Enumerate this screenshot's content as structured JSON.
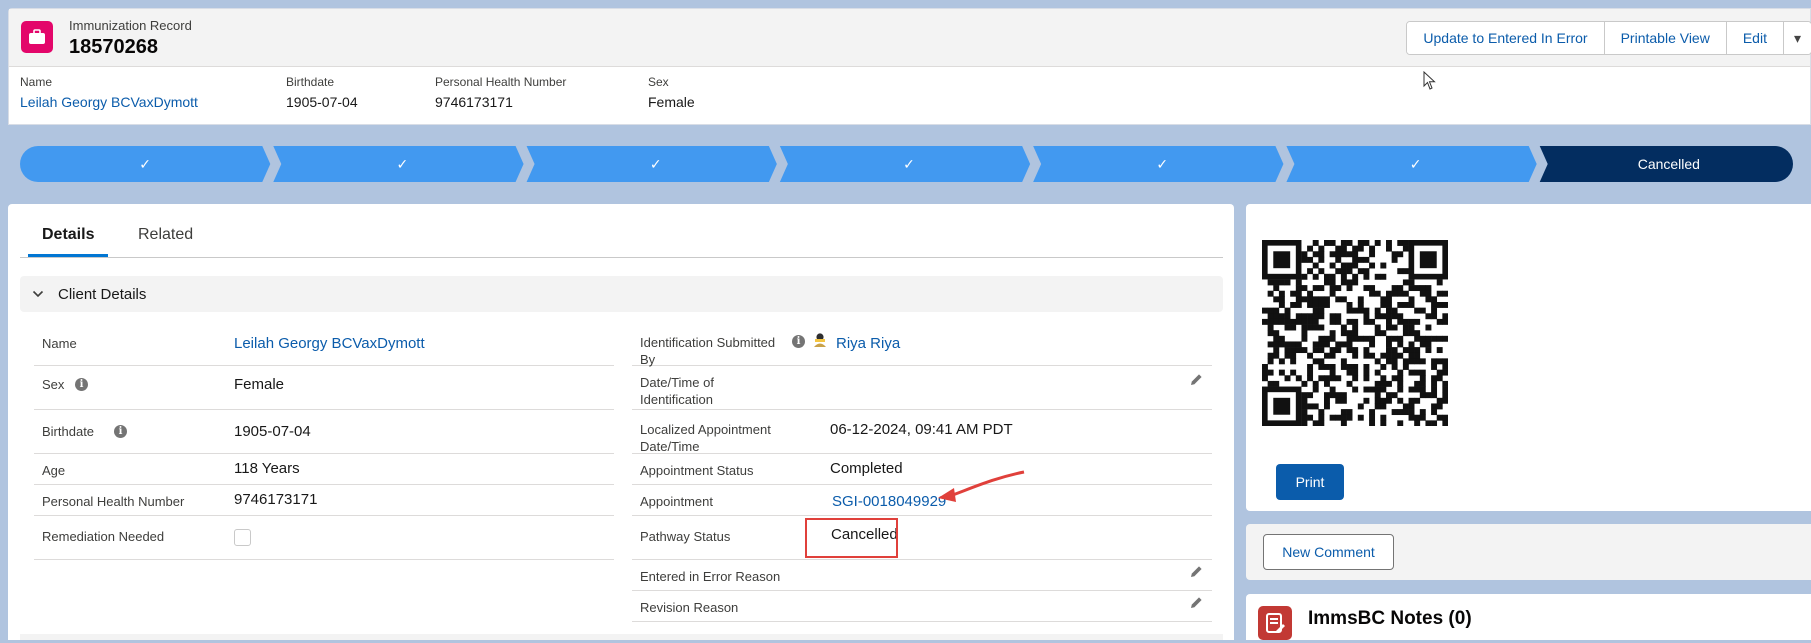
{
  "header": {
    "object_type": "Immunization Record",
    "record_number": "18570268",
    "actions": {
      "entered_in_error": "Update to Entered In Error",
      "printable_view": "Printable View",
      "edit": "Edit",
      "more": "▾"
    },
    "highlights": {
      "name_label": "Name",
      "name_value": "Leilah Georgy BCVaxDymott",
      "birthdate_label": "Birthdate",
      "birthdate_value": "1905-07-04",
      "phn_label": "Personal Health Number",
      "phn_value": "9746173171",
      "sex_label": "Sex",
      "sex_value": "Female"
    }
  },
  "path": {
    "steps": [
      {
        "label": "✓",
        "status": "complete"
      },
      {
        "label": "✓",
        "status": "complete"
      },
      {
        "label": "✓",
        "status": "complete"
      },
      {
        "label": "✓",
        "status": "complete"
      },
      {
        "label": "✓",
        "status": "complete"
      },
      {
        "label": "✓",
        "status": "complete"
      },
      {
        "label": "Cancelled",
        "status": "current"
      }
    ],
    "colors": {
      "complete": "#4299f0",
      "current": "#032d60"
    }
  },
  "tabs": {
    "details": "Details",
    "related": "Related"
  },
  "section": {
    "title": "Client Details"
  },
  "left_fields": {
    "name_label": "Name",
    "name_value": "Leilah Georgy BCVaxDymott",
    "sex_label": "Sex",
    "sex_value": "Female",
    "birthdate_label": "Birthdate",
    "birthdate_value": "1905-07-04",
    "age_label": "Age",
    "age_value": "118 Years",
    "phn_label": "Personal Health Number",
    "phn_value": "9746173171",
    "remediation_label": "Remediation Needed",
    "remediation_checked": false
  },
  "right_fields": {
    "id_submitted_label_1": "Identification Submitted",
    "id_submitted_label_2": "By",
    "id_submitted_value": "Riya Riya",
    "datetime_id_label_1": "Date/Time of",
    "datetime_id_label_2": "Identification",
    "localized_appt_label_1": "Localized Appointment",
    "localized_appt_label_2": "Date/Time",
    "localized_appt_value": "06-12-2024, 09:41 AM PDT",
    "appt_status_label": "Appointment Status",
    "appt_status_value": "Completed",
    "appointment_label": "Appointment",
    "appointment_value": "SGI-0018049929",
    "pathway_status_label": "Pathway Status",
    "pathway_status_value": "Cancelled",
    "error_reason_label": "Entered in Error Reason",
    "revision_reason_label": "Revision Reason"
  },
  "qr_panel": {
    "print_label": "Print"
  },
  "comments": {
    "new_comment_label": "New Comment"
  },
  "notes": {
    "title": "ImmsBC Notes (0)"
  },
  "colors": {
    "brand": "#0b5cab",
    "annotation_red": "#e0403b",
    "record_icon": "#e3066a",
    "notes_icon": "#c23934"
  }
}
